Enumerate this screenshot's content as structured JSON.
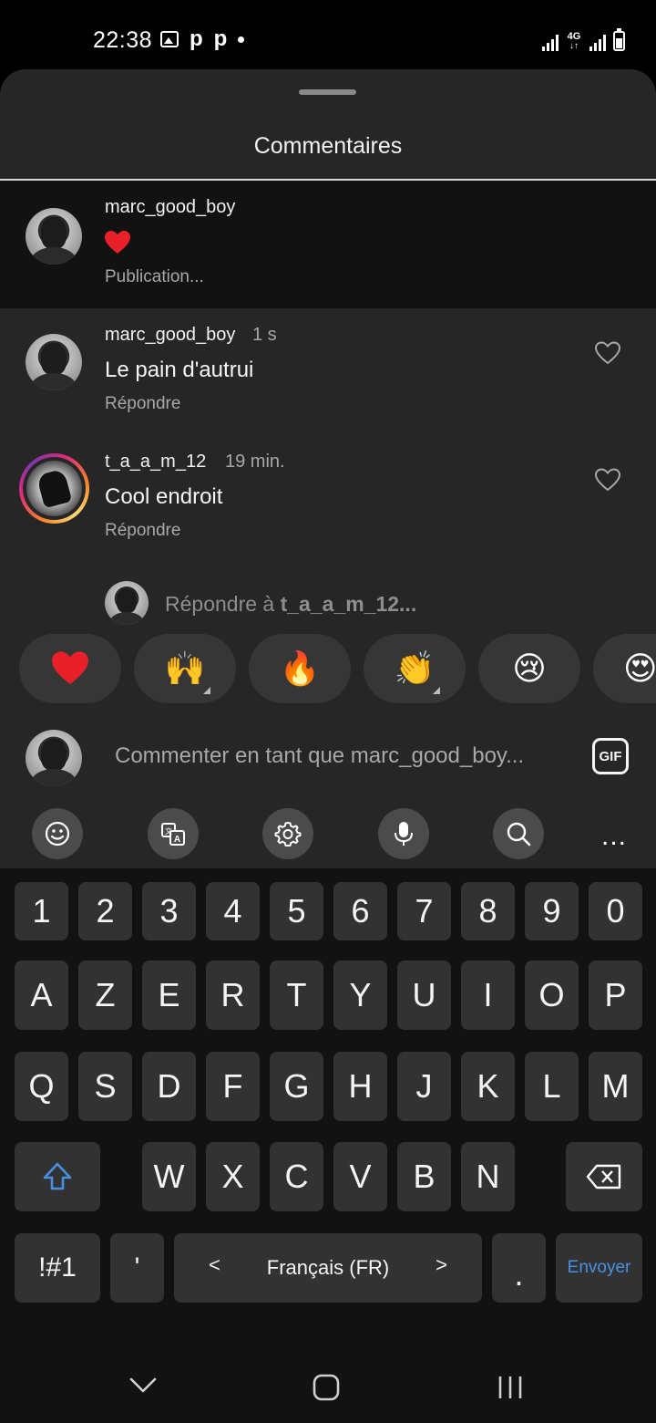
{
  "status_bar": {
    "time": "22:38",
    "network": "4G"
  },
  "sheet": {
    "title": "Commentaires"
  },
  "pending_comment": {
    "username": "marc_good_boy",
    "emoji": "❤️",
    "status": "Publication..."
  },
  "comments": [
    {
      "username": "marc_good_boy",
      "time": "1 s",
      "text": "Le pain d'autrui",
      "reply_label": "Répondre"
    },
    {
      "username": "t_a_a_m_12",
      "time": "19 min.",
      "text": "Cool endroit",
      "reply_label": "Répondre"
    }
  ],
  "reply_prompt": {
    "prefix": "Répondre à ",
    "target": "t_a_a_m_12..."
  },
  "reactions": [
    "❤️",
    "🙌",
    "🔥",
    "👏",
    "😢",
    "😍"
  ],
  "comment_input": {
    "placeholder": "Commenter en tant que marc_good_boy...",
    "gif_label": "GIF"
  },
  "keyboard_toolbar": {
    "items": [
      "emoji-icon",
      "translate-icon",
      "settings-icon",
      "microphone-icon",
      "search-icon",
      "more-icon"
    ],
    "more_label": "..."
  },
  "keyboard": {
    "row_numbers": [
      "1",
      "2",
      "3",
      "4",
      "5",
      "6",
      "7",
      "8",
      "9",
      "0"
    ],
    "row_1": [
      "A",
      "Z",
      "E",
      "R",
      "T",
      "Y",
      "U",
      "I",
      "O",
      "P"
    ],
    "row_2": [
      "Q",
      "S",
      "D",
      "F",
      "G",
      "H",
      "J",
      "K",
      "L",
      "M"
    ],
    "row_3": [
      "W",
      "X",
      "C",
      "V",
      "B",
      "N"
    ],
    "symbols_label": "!#1",
    "apostrophe_label": "'",
    "language_label": "Français (FR)",
    "lang_prev": "<",
    "lang_next": ">",
    "period_label": ".",
    "send_label": "Envoyer",
    "accent_color": "#4a90e2"
  },
  "colors": {
    "sheet_bg": "#262626",
    "pending_bg": "#121212",
    "keyboard_bg": "#121212",
    "key_bg": "#323232"
  }
}
